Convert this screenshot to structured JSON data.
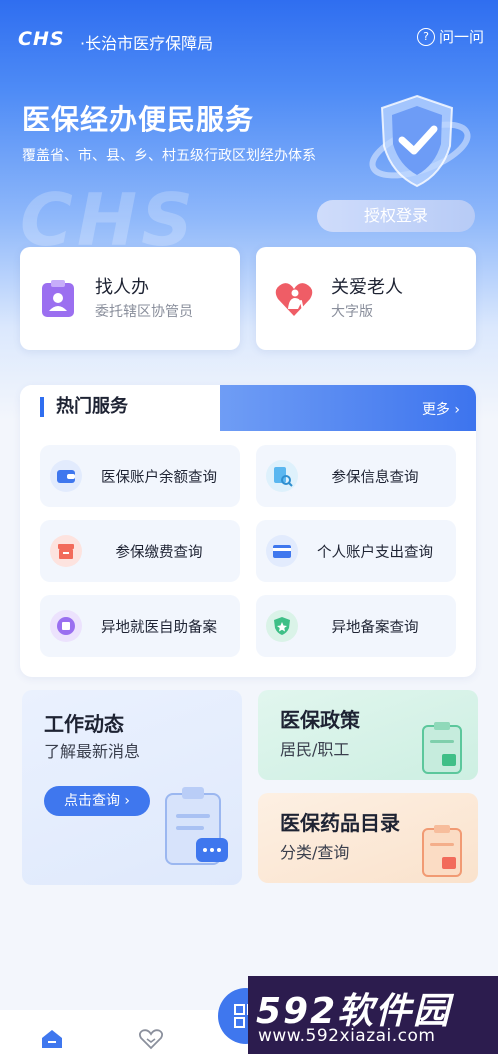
{
  "header": {
    "logo": "CHS",
    "bureau": "·长治市医疗保障局",
    "help_label": "问一问"
  },
  "hero": {
    "title": "医保经办便民服务",
    "subtitle": "覆盖省、市、县、乡、村五级行政区划经办体系",
    "watermark": "CHS",
    "login_label": "授权登录"
  },
  "quick": [
    {
      "title": "找人办",
      "sub": "委托辖区协管员",
      "icon": "clipboard-person-icon"
    },
    {
      "title": "关爱老人",
      "sub": "大字版",
      "icon": "heart-elder-icon"
    }
  ],
  "hot_services": {
    "title": "热门服务",
    "more_label": "更多 ›",
    "items": [
      {
        "label": "医保账户余额查询",
        "icon": "wallet-icon",
        "color": "#3f77ee"
      },
      {
        "label": "参保信息查询",
        "icon": "document-search-icon",
        "color": "#5ab7f0"
      },
      {
        "label": "参保缴费查询",
        "icon": "payment-box-icon",
        "color": "#f26b5b"
      },
      {
        "label": "个人账户支出查询",
        "icon": "card-icon",
        "color": "#3f77ee"
      },
      {
        "label": "异地就医自助备案",
        "icon": "record-badge-icon",
        "color": "#9a6ff0"
      },
      {
        "label": "异地备案查询",
        "icon": "shield-star-icon",
        "color": "#3fbf87"
      }
    ]
  },
  "news": {
    "title": "工作动态",
    "sub": "了解最新消息",
    "button_label": "点击查询 ›"
  },
  "policy": {
    "title": "医保政策",
    "sub": "居民/职工"
  },
  "drugs": {
    "title": "医保药品目录",
    "sub": "分类/查询"
  },
  "brand": {
    "name_num": "592",
    "name_cn": "软件园",
    "url": "www.592xiazai.com"
  },
  "colors": {
    "primary": "#2f6ef0",
    "accent_green": "#3fbf87",
    "accent_red": "#f26b5b"
  }
}
